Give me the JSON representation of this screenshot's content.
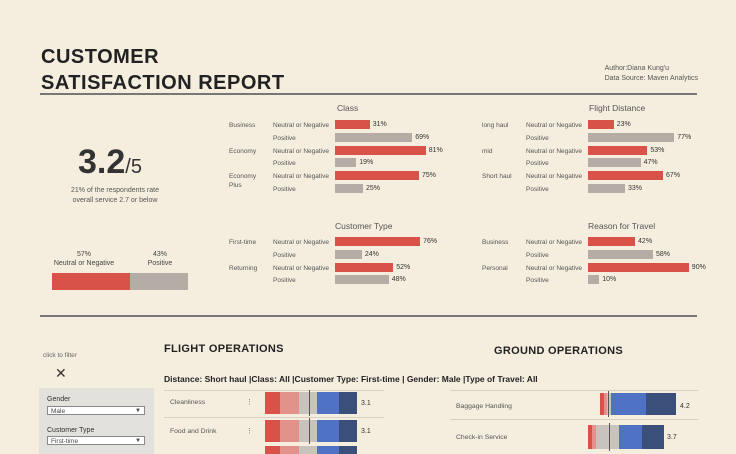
{
  "header": {
    "title_line1": "CUSTOMER",
    "title_line2": "SATISFACTION REPORT",
    "author": "Author:Diana Kung'u",
    "source_label": "Data Source: ",
    "source_value": "Maven Analytics"
  },
  "kpi": {
    "score": "3.2",
    "scale": "/5",
    "subtitle_line1": "21% of the respondents rate",
    "subtitle_line2": "overall service  2.7 or below"
  },
  "summary": {
    "neutral_pct": "57%",
    "neutral_label": "Neutral or Negative",
    "positive_pct": "43%",
    "positive_label": "Positive",
    "neutral_fraction": 0.57
  },
  "colors": {
    "negative": "#d9524a",
    "positive": "#b5aca6",
    "background": "#f5eedf"
  },
  "labels": {
    "neutral": "Neutral or Negative",
    "positive": "Positive"
  },
  "class_chart": {
    "title": "Class",
    "groups": [
      {
        "name": "Business",
        "neg": 31,
        "pos": 69,
        "neg_label": "31%",
        "pos_label": "69%"
      },
      {
        "name": "Economy",
        "neg": 81,
        "pos": 19,
        "neg_label": "81%",
        "pos_label": "19%"
      },
      {
        "name": "Economy Plus",
        "neg": 75,
        "pos": 25,
        "neg_label": "75%",
        "pos_label": "25%"
      }
    ]
  },
  "distance_chart": {
    "title": "Flight Distance",
    "groups": [
      {
        "name": "long haul",
        "neg": 23,
        "pos": 77,
        "neg_label": "23%",
        "pos_label": "77%"
      },
      {
        "name": "mid",
        "neg": 53,
        "pos": 47,
        "neg_label": "53%",
        "pos_label": "47%"
      },
      {
        "name": "Short haul",
        "neg": 67,
        "pos": 33,
        "neg_label": "67%",
        "pos_label": "33%"
      }
    ]
  },
  "customer_chart": {
    "title": "Customer Type",
    "groups": [
      {
        "name": "First-time",
        "neg": 76,
        "pos": 24,
        "neg_label": "76%",
        "pos_label": "24%"
      },
      {
        "name": "Returning",
        "neg": 52,
        "pos": 48,
        "neg_label": "52%",
        "pos_label": "48%"
      }
    ]
  },
  "travel_chart": {
    "title": "Reason for Travel",
    "groups": [
      {
        "name": "Business",
        "neg": 42,
        "pos": 58,
        "neg_label": "42%",
        "pos_label": "58%"
      },
      {
        "name": "Personal",
        "neg": 90,
        "pos": 10,
        "neg_label": "90%",
        "pos_label": "10%"
      }
    ]
  },
  "filters": {
    "hint": "click to filter",
    "clear_icon": "close-icon",
    "gender_label": "Gender",
    "gender_value": "Male",
    "customer_label": "Customer Type",
    "customer_value": "First-time"
  },
  "flight_ops": {
    "title": "FLIGHT OPERATIONS",
    "rows": [
      {
        "label": "Cleanliness",
        "value": "3.1"
      },
      {
        "label": "Food and Drink",
        "value": "3.1"
      }
    ]
  },
  "ground_ops": {
    "title": "GROUND OPERATIONS",
    "rows": [
      {
        "label": "Baggage Handling",
        "value": "4.2"
      },
      {
        "label": "Check-in Service",
        "value": "3.7"
      }
    ]
  },
  "filter_summary": "Distance: Short haul |Class: All |Customer Type: First-time | Gender: Male |Type of Travel: All"
}
